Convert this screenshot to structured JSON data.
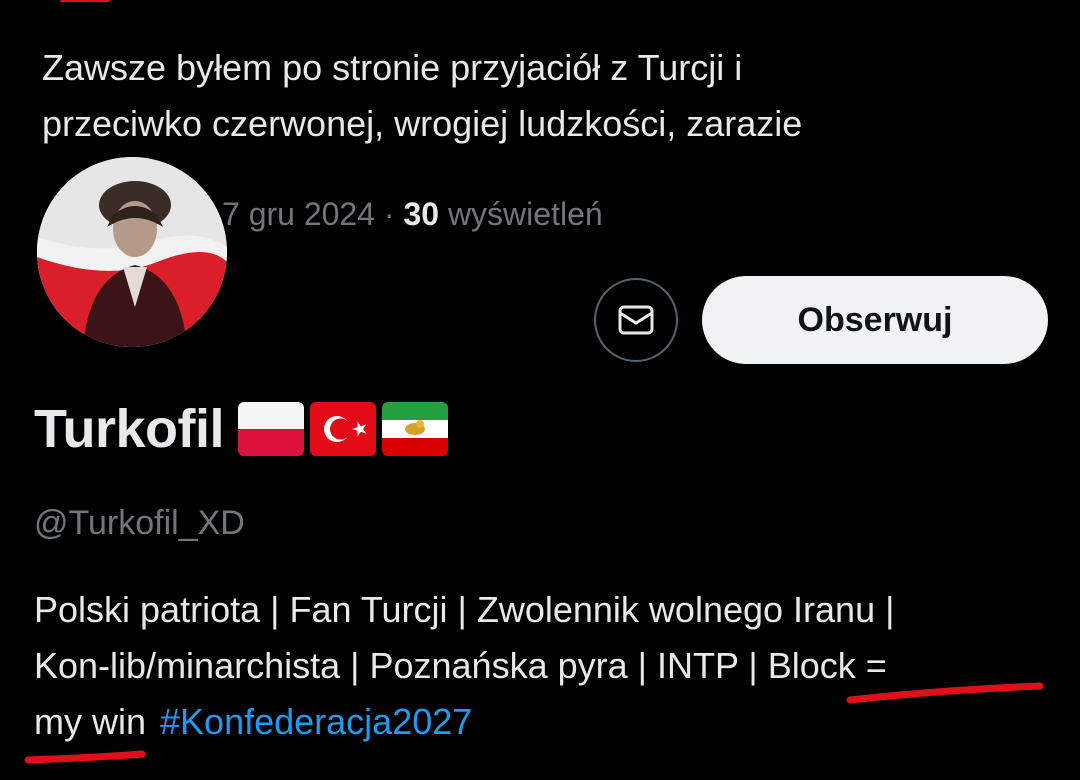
{
  "tweet": {
    "line1": "Zawsze byłem po stronie przyjaciół z Turcji i",
    "line2": "przeciwko czerwonej, wrogiej ludzkości, zarazie",
    "date": "7 gru 2024",
    "separator": "·",
    "views_count": "30",
    "views_label": "wyświetleń"
  },
  "profile": {
    "display_name": "Turkofil",
    "flags": [
      "poland-flag",
      "turkey-flag",
      "iran-lion-and-sun-flag"
    ],
    "handle": "@Turkofil_XD",
    "bio_line1": "Polski patriota | Fan Turcji | Zwolennik wolnego Iranu |",
    "bio_line2": "Kon-lib/minarchista | Poznańska pyra | INTP | Block =",
    "bio_line3": "my win",
    "hashtag": "#Konfederacja2027"
  },
  "actions": {
    "message_icon": "envelope-icon",
    "follow_label": "Obserwuj"
  },
  "colors": {
    "background": "#000000",
    "text": "#e7e9ea",
    "muted": "#71767b",
    "link": "#1d9bf0",
    "follow_bg": "#eff3f4",
    "annotation_red": "#e0101a"
  }
}
